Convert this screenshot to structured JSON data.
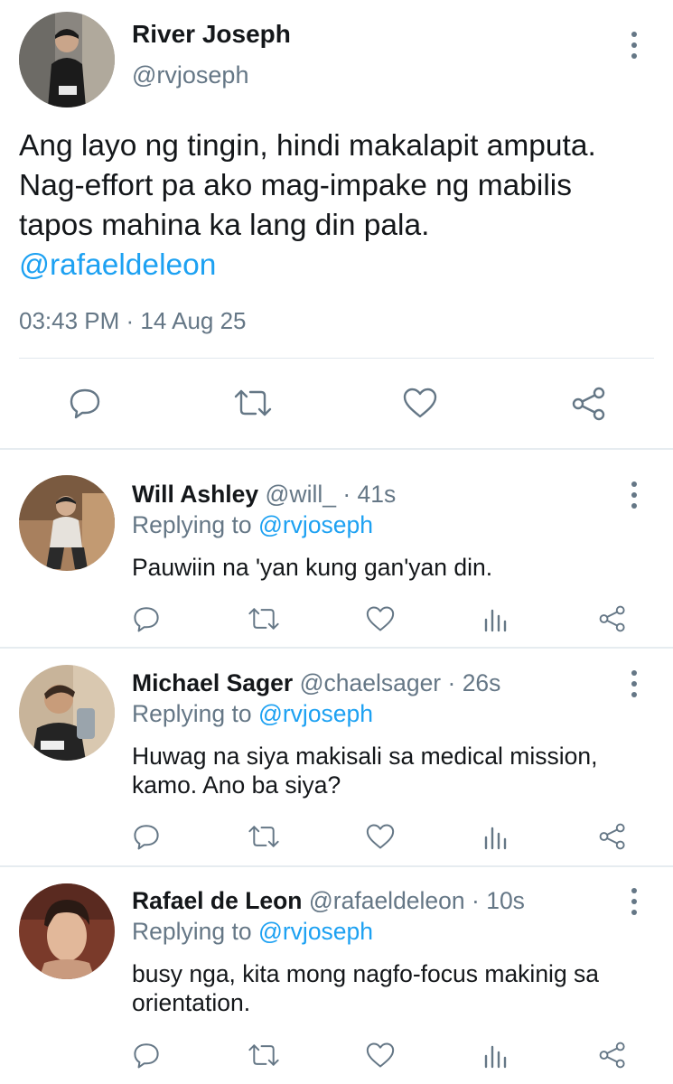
{
  "main_tweet": {
    "author_name": "River Joseph",
    "handle": "@rvjoseph",
    "text_lines": [
      "Ang layo ng tingin, hindi makalapit amputa.",
      "Nag-effort pa ako mag-impake ng mabilis",
      "tapos mahina ka lang din pala."
    ],
    "mention": "@rafaeldeleon",
    "timestamp": "03:43 PM · 14 Aug 25",
    "actions": [
      "reply-icon",
      "retweet-icon",
      "like-icon",
      "share-icon"
    ]
  },
  "replies": [
    {
      "author_name": "Will Ashley",
      "handle": "@will_",
      "time": " · 41s",
      "replying_prefix": "Replying to ",
      "replying_to": "@rvjoseph",
      "text": "Pauwiin na 'yan kung gan'yan din."
    },
    {
      "author_name": "Michael Sager",
      "handle": "@chaelsager",
      "time": " · 26s",
      "replying_prefix": "Replying to ",
      "replying_to": "@rvjoseph",
      "text": "Huwag na siya makisali sa medical mission, kamo. Ano ba siya?"
    },
    {
      "author_name": "Rafael de Leon",
      "handle": "@rafaeldeleon",
      "time": " · 10s",
      "replying_prefix": "Replying to ",
      "replying_to": "@rvjoseph",
      "text": "busy nga, kita mong nagfo-focus makinig sa orientation."
    }
  ],
  "reply_actions": [
    "reply-icon",
    "retweet-icon",
    "like-icon",
    "analytics-icon",
    "share-icon"
  ],
  "colors": {
    "accent": "#1da1f2",
    "muted": "#657786",
    "text": "#14171a",
    "divider": "#e6ecf0"
  }
}
